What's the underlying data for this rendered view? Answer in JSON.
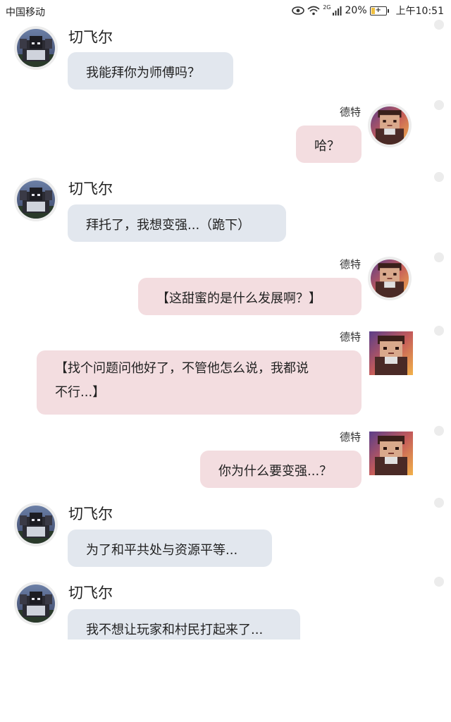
{
  "status_bar": {
    "carrier": "中国移动",
    "network": "2G",
    "battery": "20%",
    "time": "上午10:51"
  },
  "characters": {
    "left": "切飞尔",
    "right": "德特"
  },
  "messages": [
    {
      "side": "left",
      "name": "切飞尔",
      "text": "我能拜你为师傅吗？"
    },
    {
      "side": "right",
      "name": "德特",
      "text": "哈？"
    },
    {
      "side": "left",
      "name": "切飞尔",
      "text": "拜托了，我想变强...（跪下）"
    },
    {
      "side": "right",
      "name": "德特",
      "text": "【这甜蜜的是什么发展啊？】"
    },
    {
      "side": "right",
      "name": "德特",
      "text_line1": "【找个问题问他好了，不管他怎么说，我都说",
      "text_line2": "不行...】"
    },
    {
      "side": "right",
      "name": "德特",
      "text": "你为什么要变强...？"
    },
    {
      "side": "left",
      "name": "切飞尔",
      "text": "为了和平共处与资源平等..."
    },
    {
      "side": "left",
      "name": "切飞尔",
      "text": "我不想让玩家和村民打起来了..."
    }
  ],
  "colors": {
    "left_bubble": "#e2e7ee",
    "right_bubble": "#f3dde0",
    "avatar_ring": "#ececec"
  },
  "icons": {
    "left_avatar": "dark-knight-avatar",
    "right_avatar": "sunset-boy-avatar"
  }
}
